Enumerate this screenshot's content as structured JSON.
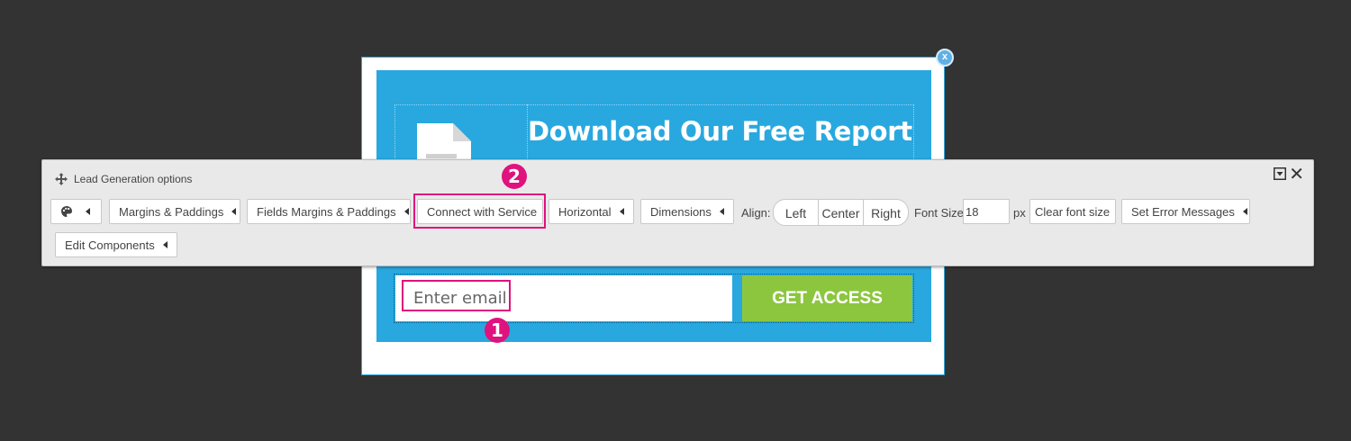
{
  "popup": {
    "close_label": "x",
    "headline": "Download Our Free Report",
    "email_placeholder": "Enter email",
    "cta_label": "GET ACCESS"
  },
  "toolbar": {
    "title": "Lead Generation options",
    "buttons": {
      "margins": "Margins & Paddings",
      "fields_margins": "Fields Margins & Paddings",
      "connect": "Connect with Service",
      "horizontal": "Horizontal",
      "dimensions": "Dimensions",
      "clear_font": "Clear font size",
      "error_messages": "Set Error Messages",
      "edit_components": "Edit Components"
    },
    "align_label": "Align:",
    "align_options": [
      "Left",
      "Center",
      "Right"
    ],
    "font_size_label": "Font Size",
    "font_size_value": "18",
    "font_size_unit": "px"
  },
  "markers": {
    "one": "1",
    "two": "2"
  },
  "colors": {
    "background": "#333333",
    "popup_blue": "#28a8df",
    "cta_green": "#8cc63f",
    "highlight": "#e0127d"
  }
}
